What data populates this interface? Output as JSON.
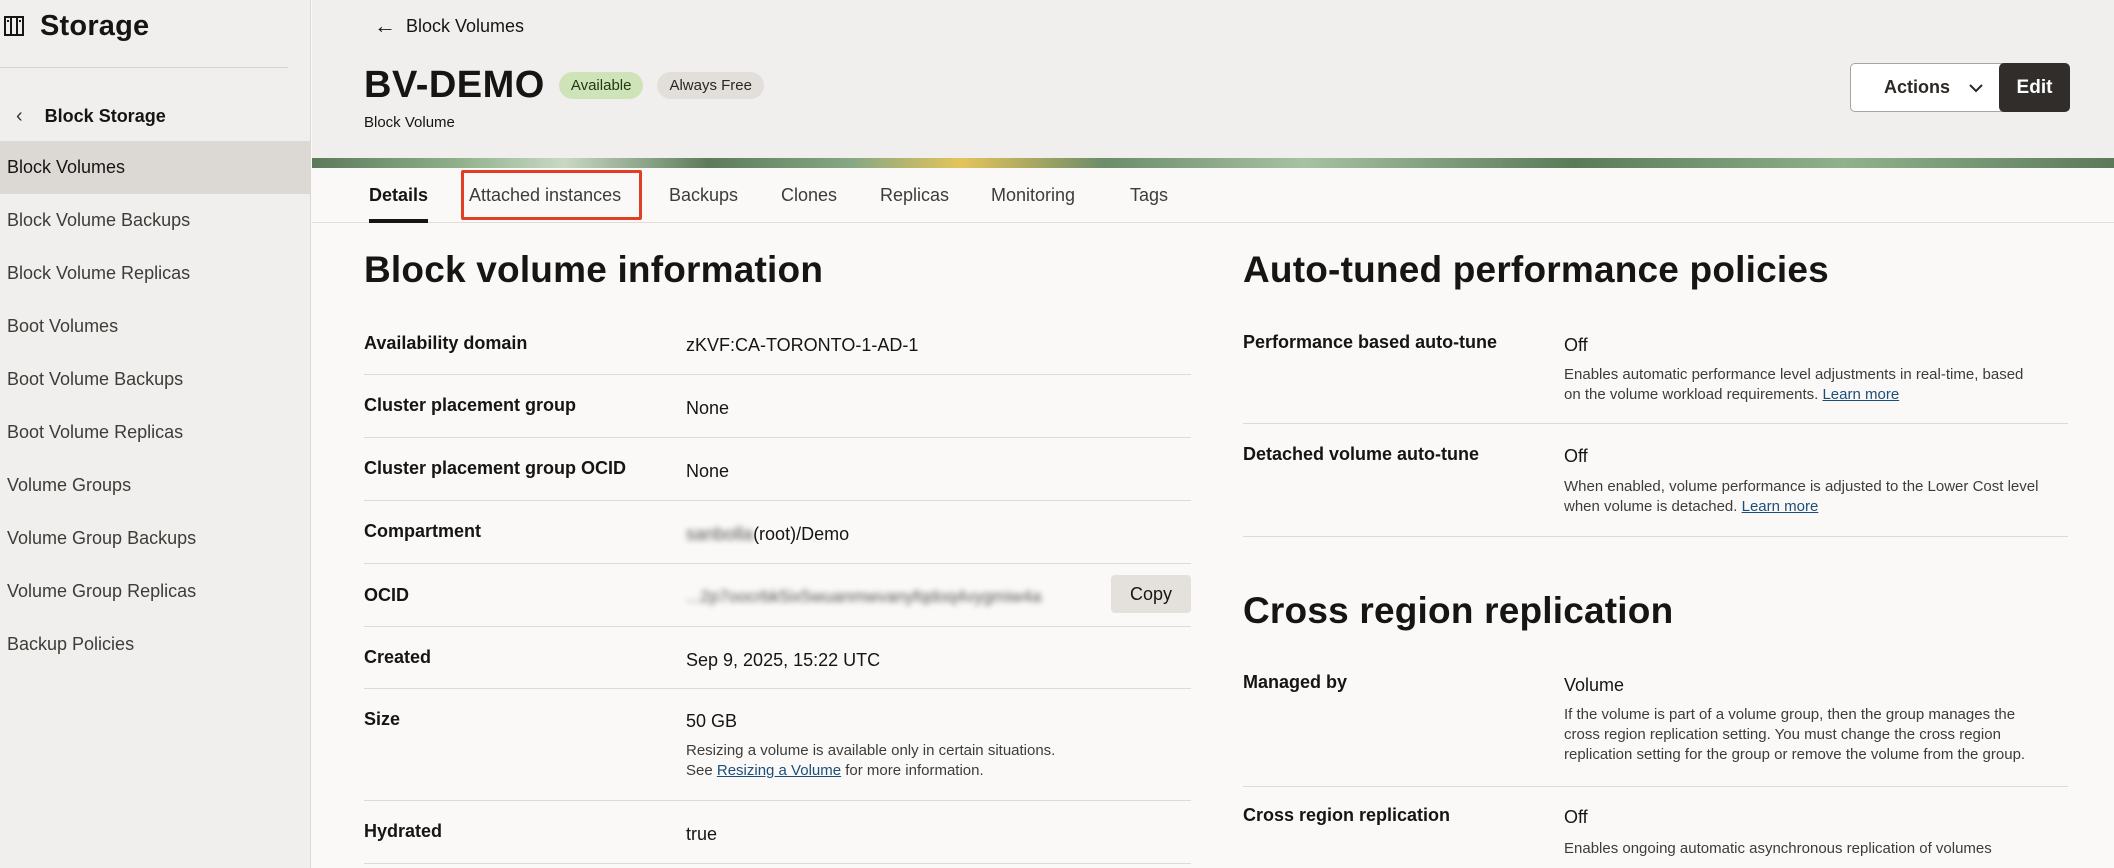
{
  "sidebar": {
    "brand_title": "Storage",
    "back_label": "Block Storage",
    "items": [
      {
        "label": "Block Volumes",
        "active": true
      },
      {
        "label": "Block Volume Backups"
      },
      {
        "label": "Block Volume Replicas"
      },
      {
        "label": "Boot Volumes"
      },
      {
        "label": "Boot Volume Backups"
      },
      {
        "label": "Boot Volume Replicas"
      },
      {
        "label": "Volume Groups"
      },
      {
        "label": "Volume Group Backups"
      },
      {
        "label": "Volume Group Replicas"
      },
      {
        "label": "Backup Policies"
      }
    ]
  },
  "header": {
    "breadcrumb": "Block Volumes",
    "title": "BV-DEMO",
    "badge_available": "Available",
    "badge_free": "Always Free",
    "subtitle": "Block Volume",
    "actions_label": "Actions",
    "edit_label": "Edit"
  },
  "tabs": [
    "Details",
    "Attached instances",
    "Backups",
    "Clones",
    "Replicas",
    "Monitoring",
    "Tags"
  ],
  "info": {
    "title": "Block volume information",
    "rows": {
      "ad": {
        "label": "Availability domain",
        "value": "zKVF:CA-TORONTO-1-AD-1"
      },
      "cpg": {
        "label": "Cluster placement group",
        "value": "None"
      },
      "cpg_ocid": {
        "label": "Cluster placement group OCID",
        "value": "None"
      },
      "compartment": {
        "label": "Compartment",
        "blurred": "sanbolla",
        "value": "(root)/Demo"
      },
      "ocid": {
        "label": "OCID",
        "value": "...2p7oocrbk5ix5wuanmwvanyfqdoq4vygmiw4a",
        "copy": "Copy"
      },
      "created": {
        "label": "Created",
        "value": "Sep 9, 2025, 15:22 UTC"
      },
      "size": {
        "label": "Size",
        "value": "50 GB",
        "help1": "Resizing a volume is available only in certain situations.",
        "help2_pre": "See ",
        "help2_link": "Resizing a Volume",
        "help2_post": " for more information."
      },
      "hydrated": {
        "label": "Hydrated",
        "value": "true"
      }
    }
  },
  "autotune": {
    "title": "Auto-tuned performance policies",
    "perf": {
      "label": "Performance based auto-tune",
      "value": "Off",
      "help1": "Enables automatic performance level adjustments in real-time, based",
      "help2": "on the volume workload requirements. ",
      "link": "Learn more"
    },
    "detached": {
      "label": "Detached volume auto-tune",
      "value": "Off",
      "help1": "When enabled, volume performance is adjusted to the Lower Cost level",
      "help2": "when volume is detached. ",
      "link": "Learn more"
    }
  },
  "replication": {
    "title": "Cross region replication",
    "managed": {
      "label": "Managed by",
      "value": "Volume",
      "help1": "If the volume is part of a volume group, then the group manages the",
      "help2": "cross region replication setting. You must change the cross region",
      "help3": "replication setting for the group or remove the volume from the group."
    },
    "crr": {
      "label": "Cross region replication",
      "value": "Off",
      "help1": "Enables ongoing automatic asynchronous replication of volumes"
    }
  }
}
